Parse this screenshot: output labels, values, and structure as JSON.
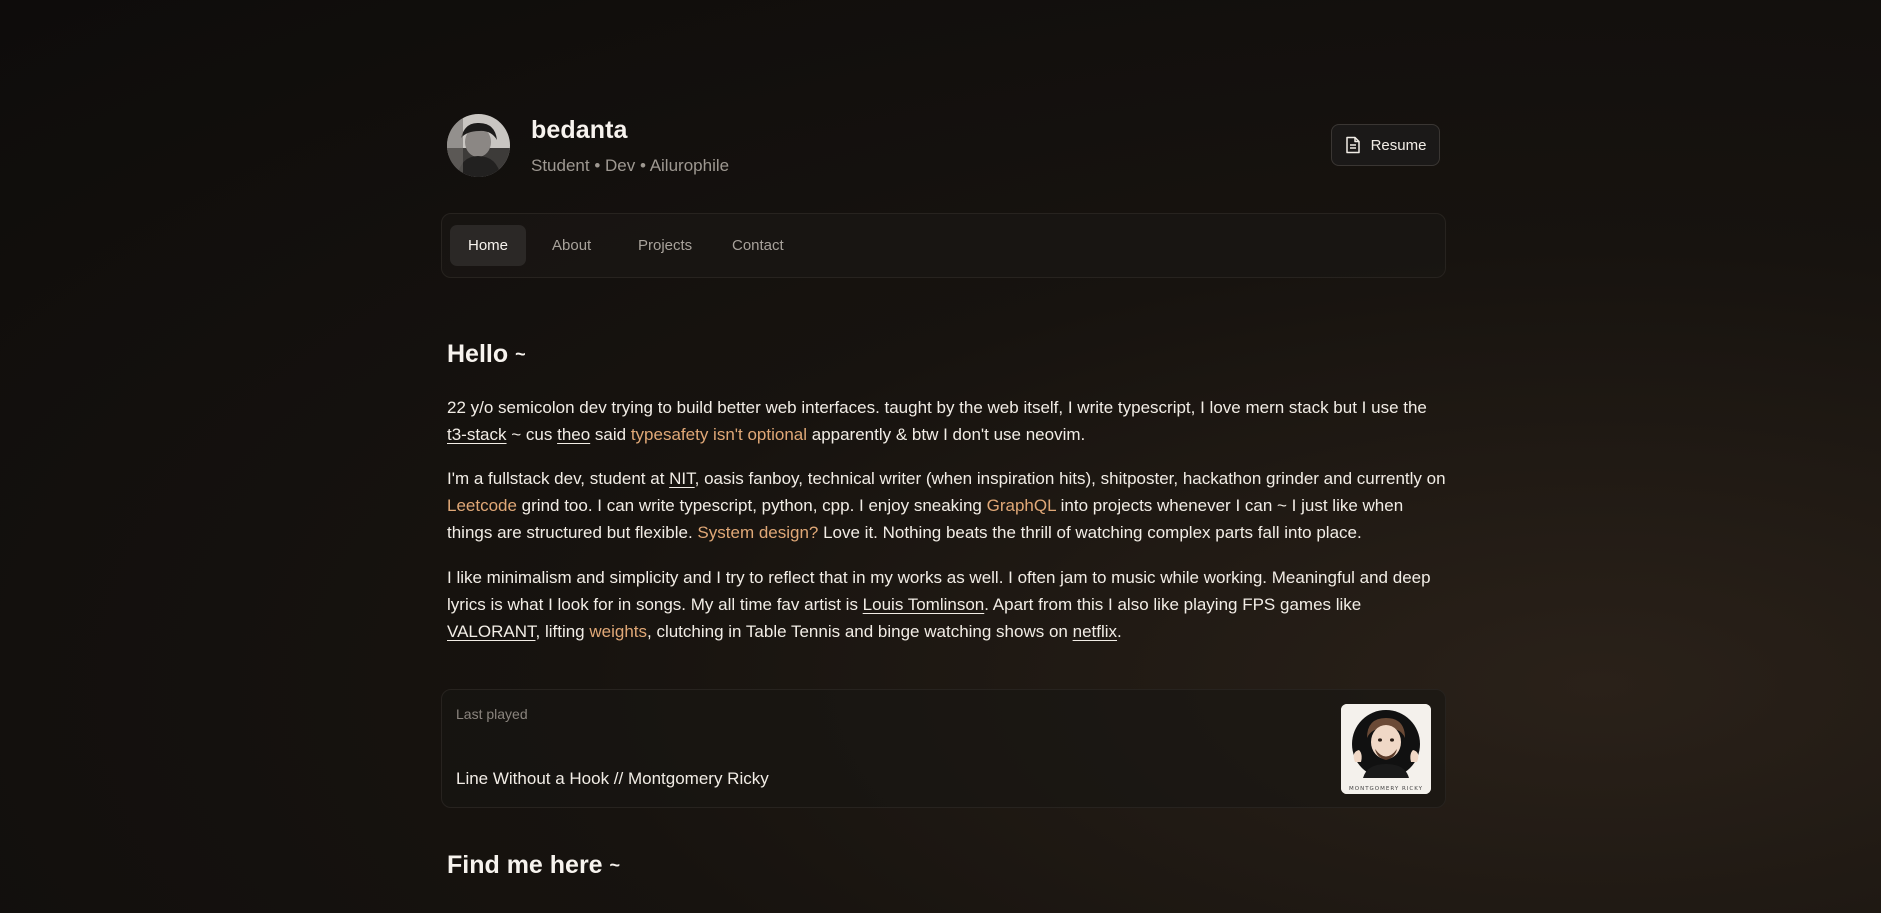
{
  "profile": {
    "name": "bedanta",
    "tagline": "Student • Dev • Ailurophile",
    "resume_label": "Resume"
  },
  "nav": {
    "items": [
      {
        "label": "Home",
        "active": true
      },
      {
        "label": "About",
        "active": false
      },
      {
        "label": "Projects",
        "active": false
      },
      {
        "label": "Contact",
        "active": false
      }
    ]
  },
  "hello": {
    "heading": "Hello",
    "tilde": "~",
    "p1": {
      "a": "22 y/o semicolon dev trying to build better web interfaces. taught by the web itself, I write typescript, I love mern stack but I use the ",
      "link1": "t3-stack",
      "b": " ~ cus ",
      "link2": "theo",
      "c": " said ",
      "hl1": "typesafety isn't optional",
      "d": " apparently & btw I don't use neovim."
    },
    "p2": {
      "a": "I'm a fullstack dev, student at ",
      "link1": "NIT",
      "b": ", oasis fanboy, technical writer (when inspiration hits), shitposter, hackathon grinder and currently on ",
      "hl1": "Leetcode",
      "c": " grind too. I can write typescript, python, cpp. I enjoy sneaking ",
      "hl2": "GraphQL",
      "d": " into projects whenever I can ~ I just like when things are structured but flexible. ",
      "hl3": "System design?",
      "e": " Love it. Nothing beats the thrill of watching complex parts fall into place."
    },
    "p3": {
      "a": "I like minimalism and simplicity and I try to reflect that in my works as well. I often jam to music while working. Meaningful and deep lyrics is what I look for in songs. My all time fav artist is ",
      "link1": "Louis Tomlinson",
      "b": ". Apart from this I also like playing FPS games like ",
      "link2": "VALORANT",
      "c": ", lifting ",
      "hl1": "weights",
      "d": ", clutching in Table Tennis and binge watching shows on ",
      "link3": "netflix",
      "e": "."
    }
  },
  "last_played": {
    "label": "Last played",
    "track": "Line Without a Hook // Montgomery Ricky",
    "album_caption": "MONTGOMERY RICKY"
  },
  "find_me": {
    "heading": "Find me here",
    "tilde": "~"
  },
  "colors": {
    "accent": "#e0a877",
    "background": "#14110f",
    "text": "#f2ede6",
    "muted": "#9e9891"
  }
}
